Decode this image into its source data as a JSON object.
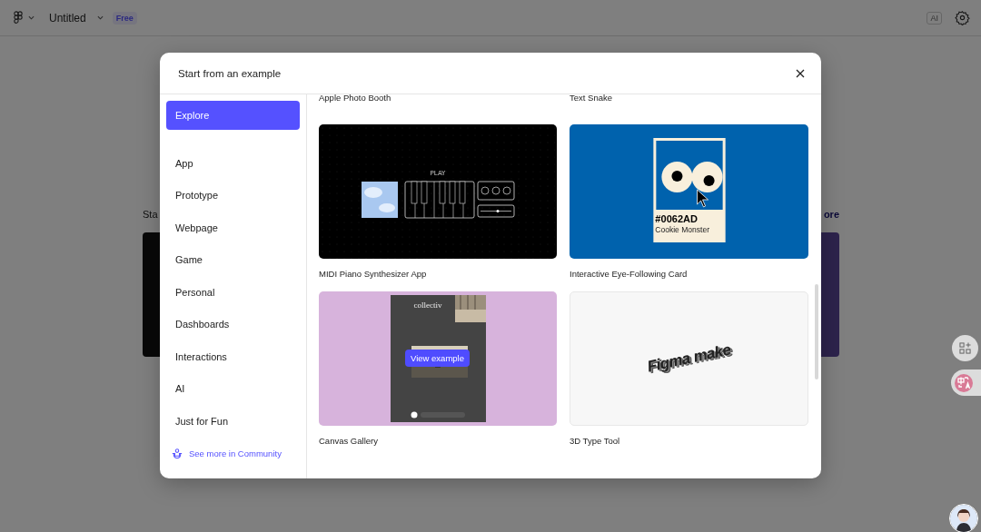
{
  "app_bar": {
    "file_name": "Untitled",
    "plan_badge": "Free",
    "ai_badge": "AI"
  },
  "background": {
    "heading": "Sta",
    "link": "ore"
  },
  "dialog": {
    "title": "Start from an example",
    "categories": [
      {
        "label": "Explore",
        "selected": true
      },
      {
        "label": "App",
        "selected": false
      },
      {
        "label": "Prototype",
        "selected": false
      },
      {
        "label": "Webpage",
        "selected": false
      },
      {
        "label": "Game",
        "selected": false
      },
      {
        "label": "Personal",
        "selected": false
      },
      {
        "label": "Dashboards",
        "selected": false
      },
      {
        "label": "Interactions",
        "selected": false
      },
      {
        "label": "AI",
        "selected": false
      },
      {
        "label": "Just for Fun",
        "selected": false
      }
    ],
    "community_link": "See more in Community",
    "titles_above": [
      "Apple Photo Booth",
      "Text Snake"
    ],
    "examples": [
      {
        "kind": "synth",
        "title": "MIDI Piano Synthesizer App",
        "hovered": false,
        "preview_text": "PLAY"
      },
      {
        "kind": "eyes",
        "title": "Interactive Eye-Following Card",
        "hovered": false,
        "preview_text": "#0062AD",
        "preview_subtext": "Cookie Monster"
      },
      {
        "kind": "gallery",
        "title": "Canvas Gallery",
        "hovered": true,
        "preview_text": "collectiv"
      },
      {
        "kind": "type3d",
        "title": "3D Type Tool",
        "hovered": false,
        "preview_text": "Figma make"
      }
    ],
    "hover_button": "View example"
  }
}
